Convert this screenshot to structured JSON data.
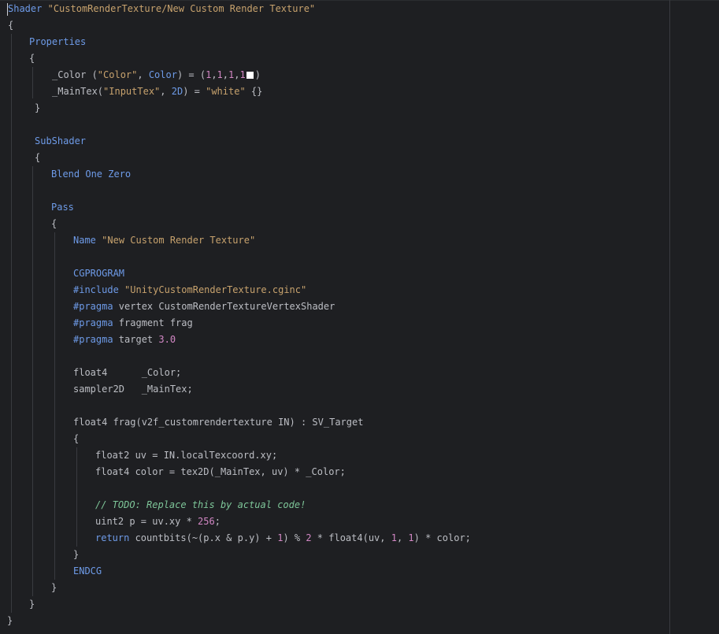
{
  "code": {
    "l1_shader": "Shader",
    "l1_name": "\"CustomRenderTexture/New Custom Render Texture\"",
    "brace_open": "{",
    "brace_close": "}",
    "l3_properties": "Properties",
    "l5_prop": "_Color (",
    "l5_str": "\"Color\"",
    "l5_sep": ", ",
    "l5_type": "Color",
    "l5_eq": ") = (",
    "l5_n1": "1",
    "l5_c1": ",",
    "l5_n2": "1",
    "l5_c2": ",",
    "l5_n3": "1",
    "l5_c3": ",",
    "l5_n4": "1",
    "l5_end": ")",
    "l6_prop": "_MainTex(",
    "l6_str": "\"InputTex\"",
    "l6_sep": ", ",
    "l6_type": "2D",
    "l6_eq": ") = ",
    "l6_default": "\"white\"",
    "l6_end": " {}",
    "l9_subshader": "SubShader",
    "l11_blend": "Blend One Zero",
    "l13_pass": "Pass",
    "l15_name_kw": "Name",
    "l15_name_val": "\"New Custom Render Texture\"",
    "l17_cgprogram": "CGPROGRAM",
    "l18_include": "#include",
    "l18_file": "\"UnityCustomRenderTexture.cginc\"",
    "l19_pragma": "#pragma",
    "l19_rest": " vertex CustomRenderTextureVertexShader",
    "l20_pragma": "#pragma",
    "l20_rest": " fragment frag",
    "l21_pragma": "#pragma",
    "l21_rest": " target ",
    "l21_num": "3.0",
    "l23_decl": "float4      _Color;",
    "l24_decl": "sampler2D   _MainTex;",
    "l26_sig": "float4 frag(v2f_customrendertexture IN) : SV_Target",
    "l28_code": "float2 uv = IN.localTexcoord.xy;",
    "l29_code": "float4 color = tex2D(_MainTex, uv) * _Color;",
    "l31_comment": "// TODO: Replace this by actual code!",
    "l32_code": "uint2 p = uv.xy * ",
    "l32_num": "256",
    "l32_end": ";",
    "l33_return": "return",
    "l33_a": " countbits(~(p.x & p.y) + ",
    "l33_n1": "1",
    "l33_b": ") % ",
    "l33_n2": "2",
    "l33_c": " * float4(uv, ",
    "l33_n3": "1",
    "l33_d": ", ",
    "l33_n4": "1",
    "l33_e": ") * color;",
    "l36_endcg": "ENDCG"
  },
  "colors": {
    "background": "#1e1f22",
    "keyword": "#6e9be8",
    "string": "#c7a26d",
    "number": "#d287c4",
    "comment": "#7ec699",
    "text": "#bcbec4"
  }
}
